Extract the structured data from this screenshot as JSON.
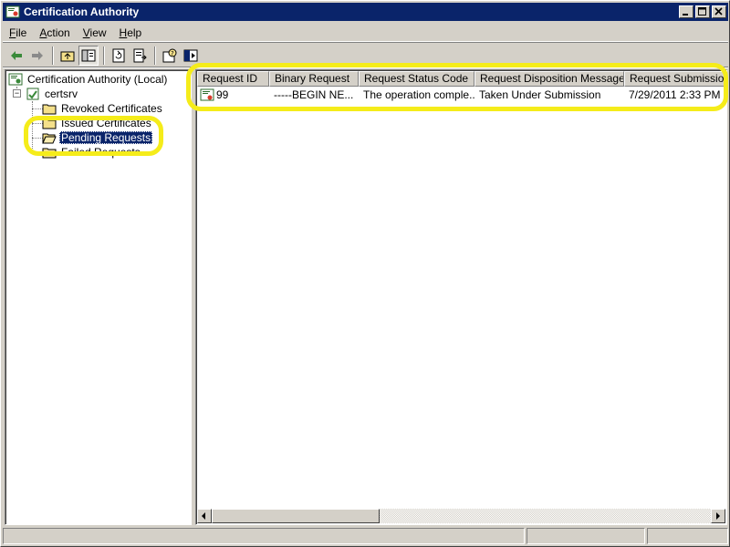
{
  "window": {
    "title": "Certification Authority",
    "controls": [
      "minimize",
      "maximize",
      "close"
    ]
  },
  "menu": {
    "items": [
      {
        "key": "F",
        "rest": "ile"
      },
      {
        "key": "A",
        "rest": "ction"
      },
      {
        "key": "V",
        "rest": "iew"
      },
      {
        "key": "H",
        "rest": "elp"
      }
    ]
  },
  "toolbar": {
    "buttons": [
      "back-icon",
      "forward-icon",
      "up-folder-icon",
      "show-hide-tree-icon",
      "refresh-icon",
      "export-list-icon",
      "help-icon",
      "properties-icon"
    ]
  },
  "tree": {
    "root": "Certification Authority (Local)",
    "server": "certsrv",
    "folders": [
      {
        "label": "Revoked Certificates",
        "selected": false
      },
      {
        "label": "Issued Certificates",
        "selected": false
      },
      {
        "label": "Pending Requests",
        "selected": true
      },
      {
        "label": "Failed Requests",
        "selected": false
      }
    ]
  },
  "list": {
    "columns": [
      "Request ID",
      "Binary Request",
      "Request Status Code",
      "Request Disposition Message",
      "Request Submission Date"
    ],
    "rows": [
      [
        "99",
        "-----BEGIN NE...",
        "The operation comple...",
        "Taken Under Submission",
        "7/29/2011 2:33 PM"
      ]
    ]
  },
  "colors": {
    "titlebar": "#0a246a",
    "highlight": "#f5ec1a",
    "face": "#d4d0c8"
  }
}
